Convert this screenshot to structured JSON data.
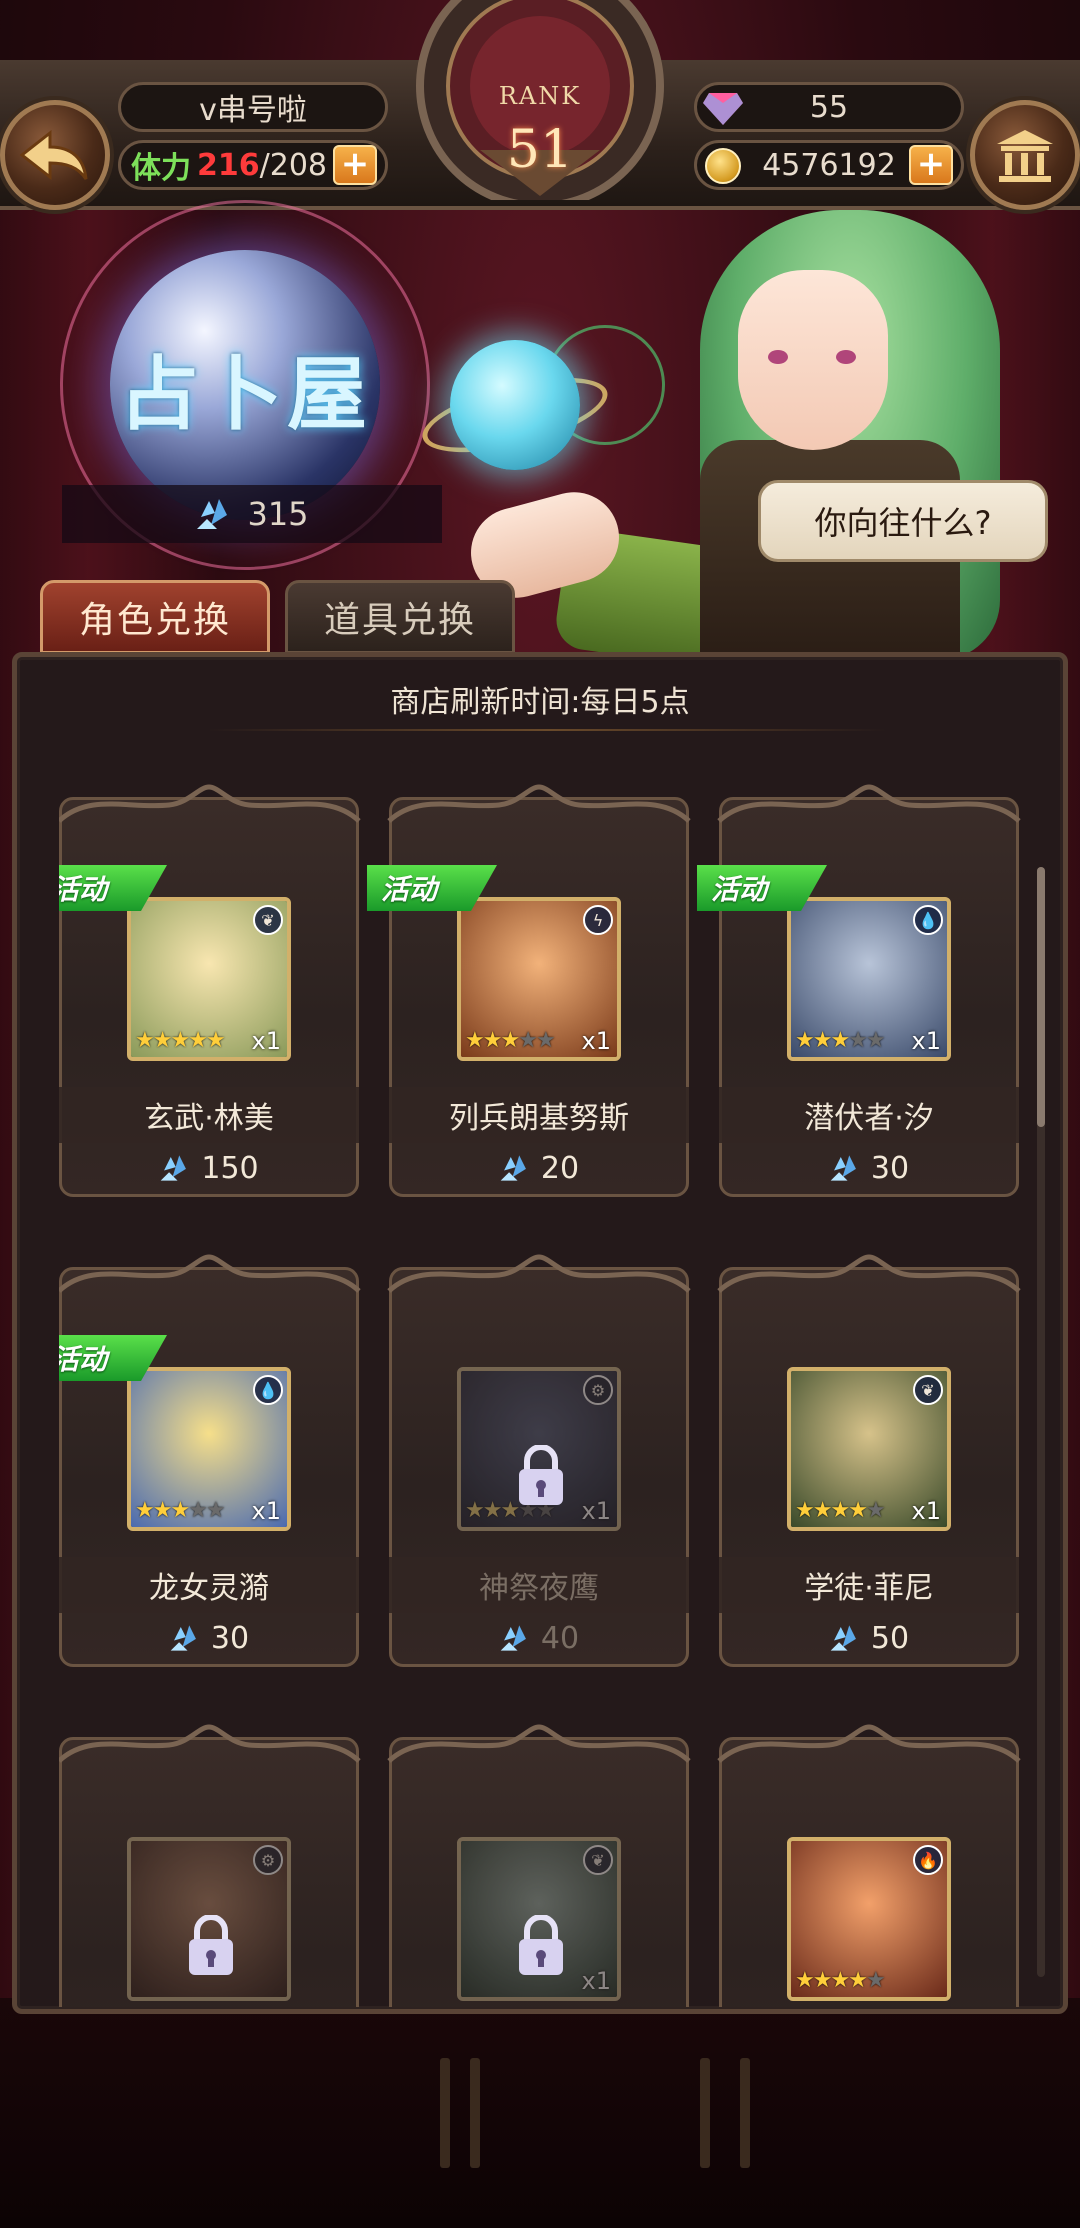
{
  "header": {
    "player_name": "v串号啦",
    "stamina_label": "体力",
    "stamina_current": "216",
    "stamina_max": "/208",
    "rank_label": "RANK",
    "rank_value": "51",
    "gems": "55",
    "gold": "4576192",
    "plus_symbol": "+"
  },
  "hero": {
    "shop_title": "占卜屋",
    "crystal_count": "315",
    "speech": "你向往什么?"
  },
  "tabs": [
    {
      "label": "角色兑换",
      "active": true
    },
    {
      "label": "道具兑换",
      "active": false
    }
  ],
  "shop": {
    "refresh_note": "商店刷新时间:每日5点",
    "event_tag": "活动",
    "items": [
      {
        "name": "玄武·林美",
        "price": "150",
        "event": true,
        "locked": false,
        "stars": 5,
        "max_stars": 5,
        "qty": "x1",
        "element": "leaf-icon",
        "art": [
          "#f8e6b0",
          "#8a9a5a"
        ]
      },
      {
        "name": "列兵朗基努斯",
        "price": "20",
        "event": true,
        "locked": false,
        "stars": 3,
        "max_stars": 5,
        "qty": "x1",
        "element": "lightning-icon",
        "art": [
          "#f2b27a",
          "#7a3a1a"
        ]
      },
      {
        "name": "潜伏者·汐",
        "price": "30",
        "event": true,
        "locked": false,
        "stars": 3,
        "max_stars": 5,
        "qty": "x1",
        "element": "water-icon",
        "art": [
          "#b8c4d8",
          "#3a4a6a"
        ]
      },
      {
        "name": "龙女灵漪",
        "price": "30",
        "event": true,
        "locked": false,
        "stars": 3,
        "max_stars": 5,
        "qty": "x1",
        "element": "water-icon",
        "art": [
          "#f6df8a",
          "#4a6ab0"
        ]
      },
      {
        "name": "神祭夜鹰",
        "price": "40",
        "event": false,
        "locked": true,
        "stars": 3,
        "max_stars": 5,
        "qty": "x1",
        "element": "gear-icon",
        "art": [
          "#4a5a8a",
          "#1a2038"
        ]
      },
      {
        "name": "学徒·菲尼",
        "price": "50",
        "event": false,
        "locked": false,
        "stars": 4,
        "max_stars": 5,
        "qty": "x1",
        "element": "leaf-icon",
        "art": [
          "#d6c28a",
          "#3a4a2a"
        ]
      },
      {
        "name": "",
        "price": "",
        "event": false,
        "locked": true,
        "stars": 0,
        "max_stars": 5,
        "qty": "",
        "element": "gear-icon",
        "art": [
          "#c87a4a",
          "#3a1a12"
        ]
      },
      {
        "name": "",
        "price": "",
        "event": false,
        "locked": true,
        "stars": 0,
        "max_stars": 5,
        "qty": "x1",
        "element": "leaf-icon",
        "art": [
          "#8ab0a0",
          "#1a3a2a"
        ]
      },
      {
        "name": "",
        "price": "",
        "event": false,
        "locked": false,
        "stars": 4,
        "max_stars": 5,
        "qty": "",
        "element": "fire-icon",
        "art": [
          "#f2a06a",
          "#6a2a1a"
        ]
      }
    ]
  },
  "colors": {
    "accent": "#d9781c",
    "stamina_current": "#ff3b3b",
    "stamina_label": "#7de05a",
    "event_tag": "#1a9a2a"
  }
}
